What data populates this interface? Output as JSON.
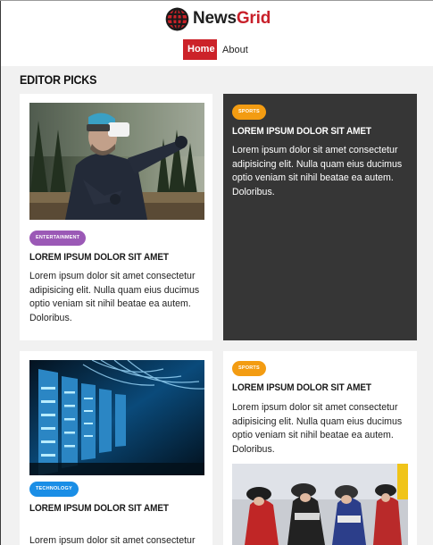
{
  "header": {
    "brand": {
      "name_primary": "News",
      "name_secondary": "Grid",
      "logo_icon": "globe-icon"
    },
    "nav": [
      {
        "label": "Home",
        "active": true
      },
      {
        "label": "About",
        "active": false
      }
    ]
  },
  "section": {
    "title": "EDITOR PICKS"
  },
  "cards": [
    {
      "tag": "ENTERTAINMENT",
      "tag_color": "#9b59b6",
      "image": "vr-headset-photo",
      "title": "LOREM IPSUM DOLOR SIT AMET",
      "body": "Lorem ipsum dolor sit amet consectetur adipisicing elit. Nulla quam eius ducimus optio veniam sit nihil beatae ea autem. Doloribus."
    },
    {
      "tag": "SPORTS",
      "tag_color": "#f39c12",
      "title": "LOREM IPSUM DOLOR SIT AMET",
      "body": "Lorem ipsum dolor sit amet consectetur adipisicing elit. Nulla quam eius ducimus optio veniam sit nihil beatae ea autem. Doloribus."
    },
    {
      "tag": "TECHNOLOGY",
      "tag_color": "#1a8ee6",
      "image": "server-rack-photo",
      "title": "LOREM IPSUM DOLOR SIT AMET",
      "body": "Lorem ipsum dolor sit amet consectetur adipisicing elit. Nulla quam eius ducimus"
    },
    {
      "tag": "SPORTS",
      "tag_color": "#f39c12",
      "image": "cycling-race-photo",
      "title": "LOREM IPSUM DOLOR SIT AMET",
      "body": "Lorem ipsum dolor sit amet consectetur adipisicing elit. Nulla quam eius ducimus optio veniam sit nihil beatae ea autem. Doloribus."
    }
  ],
  "colors": {
    "brand_red": "#cc2229",
    "dark_card": "#363636",
    "page_background": "#f1f1f1"
  }
}
